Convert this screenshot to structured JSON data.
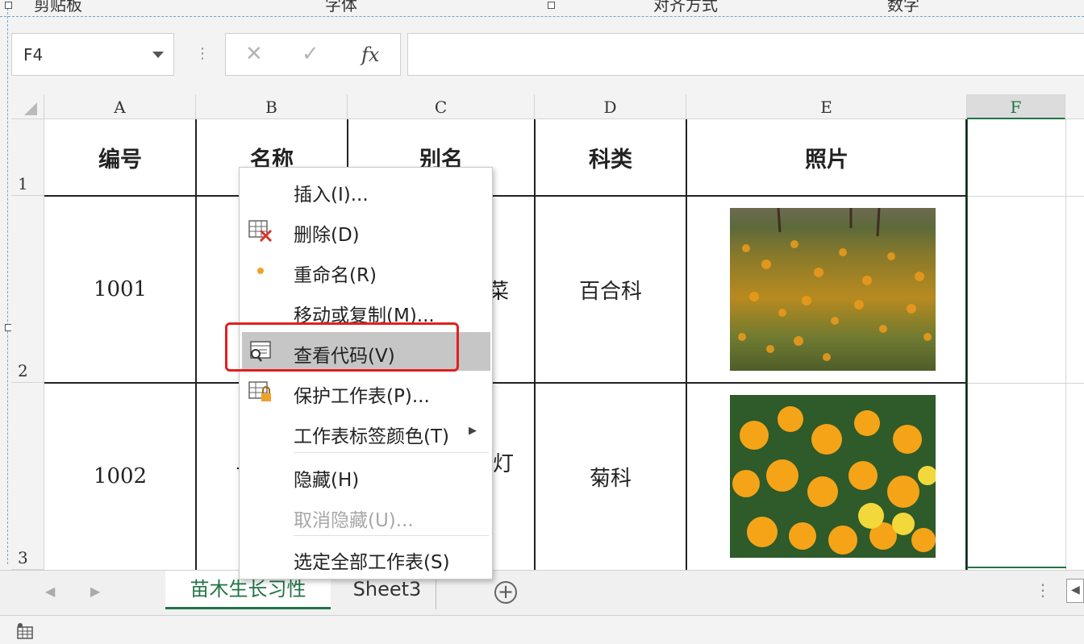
{
  "ribbon": {
    "partial_labels": [
      "剪贴板",
      "字体",
      "对齐方式",
      "数字"
    ]
  },
  "formula_bar": {
    "name_box": "F4",
    "cancel_icon": "✕",
    "enter_icon": "✓",
    "fx_label": "fx",
    "formula": ""
  },
  "columns": [
    "A",
    "B",
    "C",
    "D",
    "E",
    "F"
  ],
  "rows": [
    "1",
    "2",
    "3"
  ],
  "table": {
    "headers": {
      "a": "编号",
      "b": "名称",
      "c": "别名",
      "d": "科类",
      "e": "照片"
    },
    "row2": {
      "a": "1001",
      "c_partial": "菜",
      "d": "百合科"
    },
    "row3": {
      "a": "1002",
      "b_partial": "7",
      "c_partial": "灯",
      "d": "菊科"
    }
  },
  "context_menu": {
    "items": [
      {
        "label": "插入(I)...",
        "icon": "none"
      },
      {
        "label": "删除(D)",
        "icon": "delete-sheet-icon"
      },
      {
        "label": "重命名(R)",
        "icon": "dot-icon"
      },
      {
        "label": "移动或复制(M)...",
        "icon": "none"
      },
      {
        "label": "查看代码(V)",
        "icon": "view-code-icon",
        "highlighted": true
      },
      {
        "label": "保护工作表(P)...",
        "icon": "protect-sheet-icon"
      },
      {
        "label": "工作表标签颜色(T)",
        "icon": "none",
        "submenu": true
      },
      {
        "label": "隐藏(H)",
        "icon": "none"
      },
      {
        "label": "取消隐藏(U)...",
        "icon": "none",
        "disabled": true
      },
      {
        "label": "选定全部工作表(S)",
        "icon": "none"
      }
    ]
  },
  "sheet_tabs": {
    "active": "苗木生长习性",
    "other": "Sheet3",
    "add_icon": "+"
  },
  "colors": {
    "accent": "#217346",
    "highlight_border": "#e02020",
    "menu_highlight": "#c6c6c6"
  }
}
